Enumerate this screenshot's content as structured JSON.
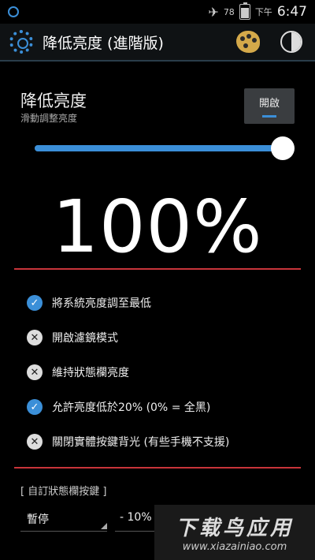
{
  "status_bar": {
    "battery": "78",
    "ampm": "下午",
    "time": "6:47"
  },
  "action_bar": {
    "title": "降低亮度 (進階版)"
  },
  "brightness": {
    "title": "降低亮度",
    "subtitle": "滑動調整亮度",
    "toggle_label": "開啟",
    "value": 1.0,
    "value_label": "100%"
  },
  "options": [
    {
      "label": "將系統亮度調至最低",
      "checked": true
    },
    {
      "label": "開啟濾鏡模式",
      "checked": false
    },
    {
      "label": "維持狀態欄亮度",
      "checked": false
    },
    {
      "label": "允許亮度低於20% (0% = 全黑)",
      "checked": true
    },
    {
      "label": "關閉實體按鍵背光 (有些手機不支援)",
      "checked": false
    }
  ],
  "custom": {
    "header": "[ 自訂狀態欄按鍵 ]",
    "spinner1": "暫停",
    "spinner2": "- 10%"
  },
  "watermark": {
    "cn": "下载鸟应用",
    "url": "www.xiazainiao.com"
  },
  "colors": {
    "accent": "#3b8fd8",
    "divider": "#c8343a",
    "background": "#000000"
  }
}
